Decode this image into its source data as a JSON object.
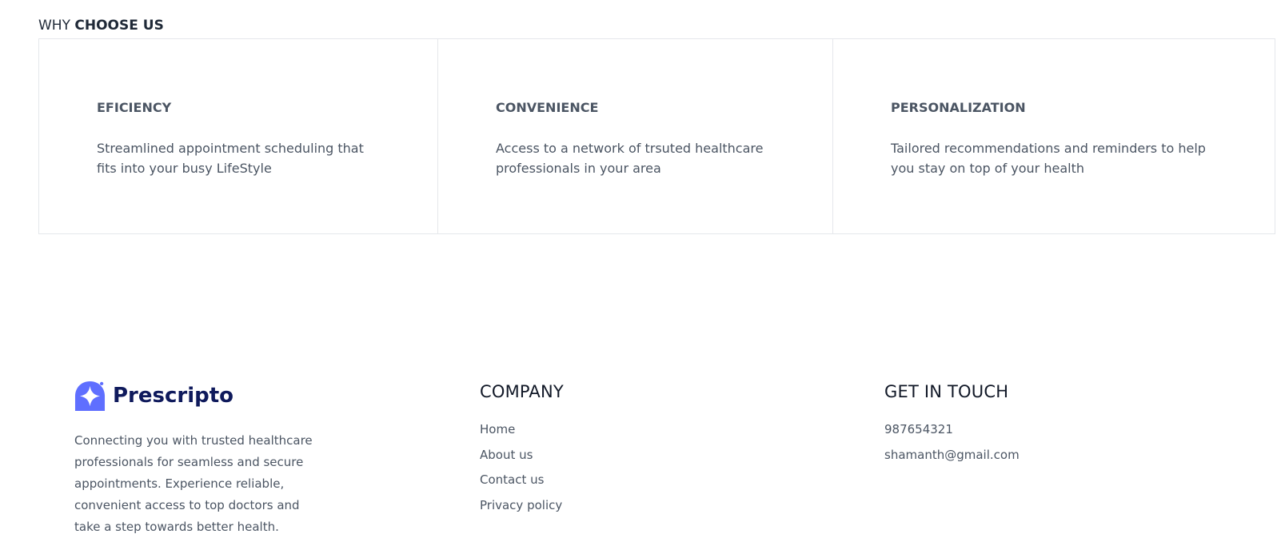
{
  "why_section": {
    "heading_prefix": "WHY ",
    "heading_strong": "CHOOSE US",
    "cards": [
      {
        "title": "EFICIENCY",
        "text": "Streamlined appointment scheduling that fits into your busy LifeStyle"
      },
      {
        "title": "CONVENIENCE",
        "text": "Access to a network of trsuted healthcare professionals in your area"
      },
      {
        "title": "PERSONALIZATION",
        "text": "Tailored recommendations and reminders to help you stay on top of your health"
      }
    ]
  },
  "footer": {
    "brand": {
      "logo_text": "Prescripto",
      "logo_icon": "sparkle-logo-icon",
      "description": "Connecting you with trusted healthcare professionals for seamless and secure appointments. Experience reliable, convenient access to top doctors and take a step towards better health."
    },
    "company": {
      "heading": "COMPANY",
      "links": [
        "Home",
        "About us",
        "Contact us",
        "Privacy policy"
      ]
    },
    "contact": {
      "heading": "GET IN TOUCH",
      "items": [
        "987654321",
        "shamanth@gmail.com"
      ]
    }
  },
  "colors": {
    "brand_primary": "#5f6fff",
    "logo_text": "#0f1a5c",
    "border": "#e5e7eb",
    "body_text": "#4b5563"
  }
}
